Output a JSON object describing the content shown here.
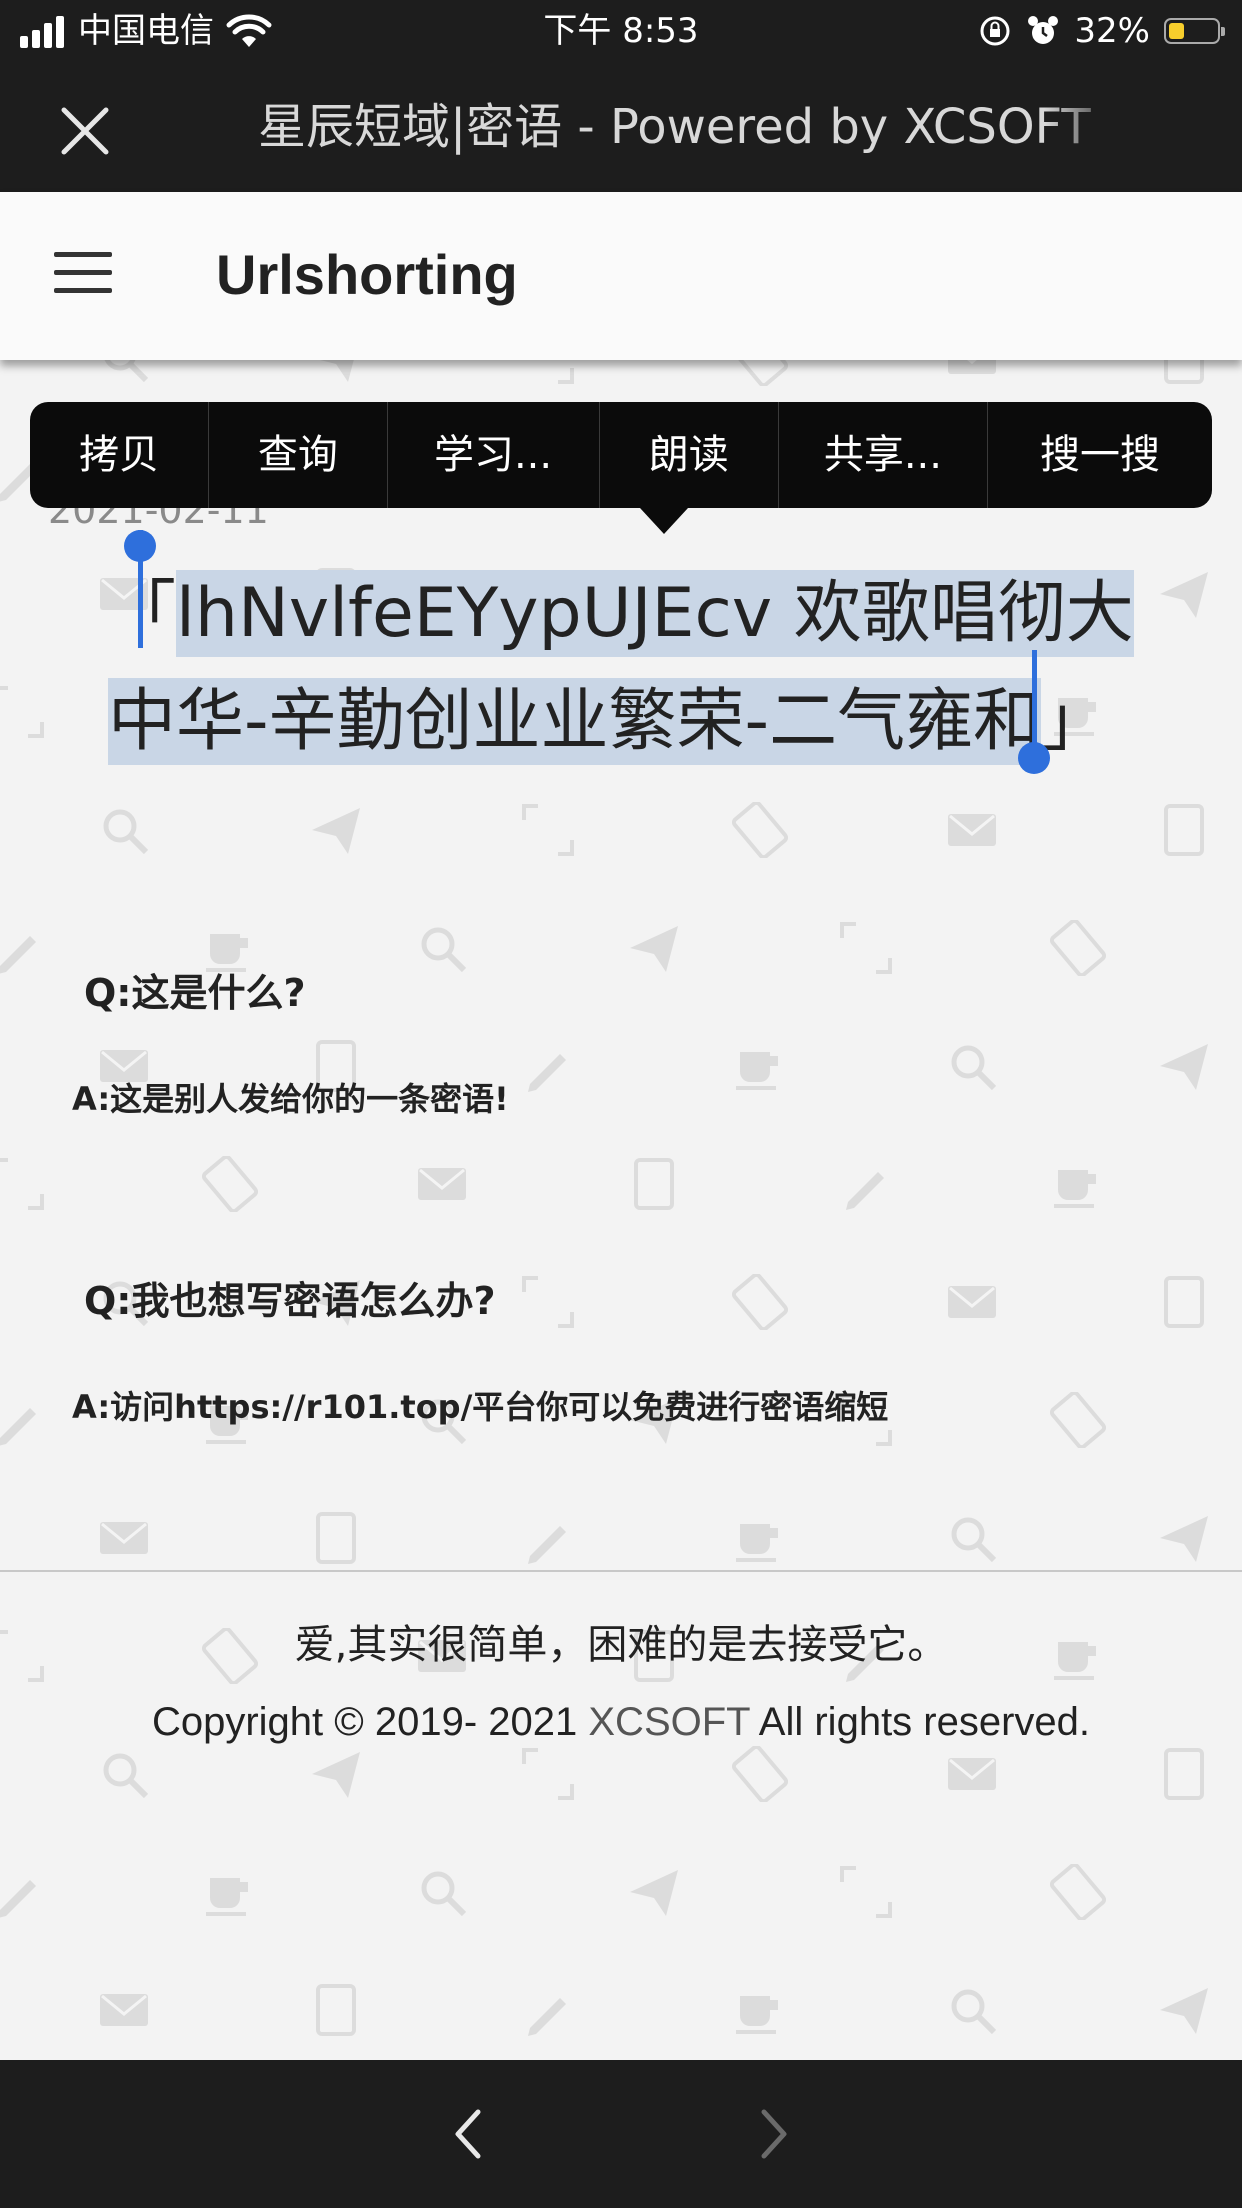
{
  "status_bar": {
    "carrier": "中国电信",
    "time": "下午 8:53",
    "battery_percent": "32%",
    "battery_level": 0.32,
    "battery_color": "#f7ce2c"
  },
  "browser": {
    "title": "星辰短域|密语 - Powered by XCSOFT",
    "close_icon": "close-icon"
  },
  "header": {
    "title": "Urlshorting",
    "menu_icon": "hamburger-icon"
  },
  "post": {
    "date": "2021-02-11",
    "open_quote": "「",
    "selected_text": "lhNvlfeEYypUJEcv 欢歌唱彻大中华-辛勤创业业繁荣-二气雍和",
    "close_quote": "」"
  },
  "context_menu": {
    "items": [
      "拷贝",
      "查询",
      "学习...",
      "朗读",
      "共享...",
      "搜一搜"
    ]
  },
  "faq": [
    {
      "q": "Q:这是什么?",
      "a": "A:这是别人发给你的一条密语!"
    },
    {
      "q": "Q:我也想写密语怎么办?",
      "a": "A:访问https://r101.top/平台你可以免费进行密语缩短"
    }
  ],
  "footer": {
    "quote": "爱,其实很简单，困难的是去接受它。",
    "copyright_prefix": "Copyright © 2019- 2021 ",
    "brand": "XCSOFT",
    "copyright_suffix": " All rights reserved."
  },
  "colors": {
    "selection": "#c9d6e6",
    "handle": "#2e6fdc",
    "bars": "#1d1d1d"
  }
}
